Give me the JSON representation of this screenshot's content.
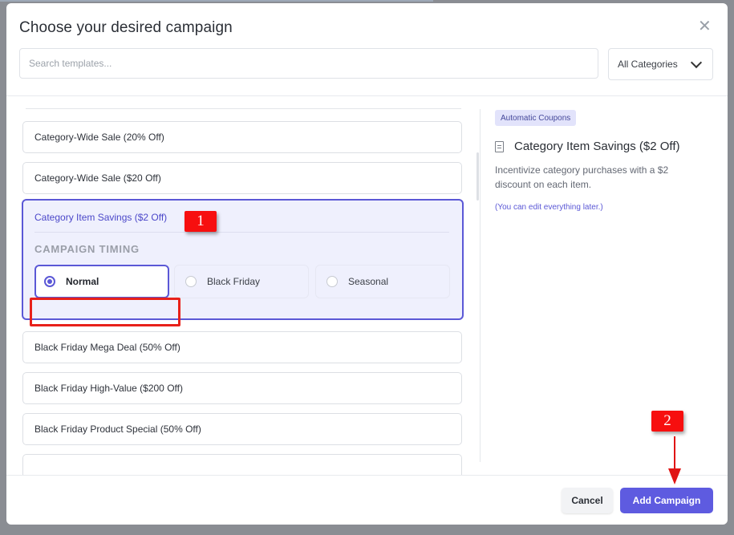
{
  "modal": {
    "title": "Choose your desired campaign",
    "close_glyph": "✕",
    "search_placeholder": "Search templates...",
    "category_select": "All Categories"
  },
  "templates": [
    {
      "label": "Category-Wide Sale (20% Off)"
    },
    {
      "label": "Category-Wide Sale ($20 Off)"
    },
    {
      "label": "Category Item Savings ($2 Off)",
      "selected": true
    },
    {
      "label": "Black Friday Mega Deal (50% Off)"
    },
    {
      "label": "Black Friday High-Value ($200 Off)"
    },
    {
      "label": "Black Friday Product Special (50% Off)"
    }
  ],
  "selected_template": {
    "label": "Category Item Savings ($2 Off)",
    "timing_label": "CAMPAIGN TIMING",
    "timing_options": [
      {
        "label": "Normal",
        "checked": true
      },
      {
        "label": "Black Friday",
        "checked": false
      },
      {
        "label": "Seasonal",
        "checked": false
      }
    ]
  },
  "preview": {
    "tag": "Automatic Coupons",
    "icon": "document-icon",
    "title": "Category Item Savings ($2 Off)",
    "description": "Incentivize category purchases with a $2 discount on each item.",
    "note": "(You can edit everything later.)"
  },
  "footer": {
    "cancel_label": "Cancel",
    "add_label": "Add Campaign"
  },
  "annotations": {
    "step1": "1",
    "step2": "2"
  },
  "colors": {
    "accent": "#5e5be0",
    "annotation_red": "#f70f0f"
  }
}
